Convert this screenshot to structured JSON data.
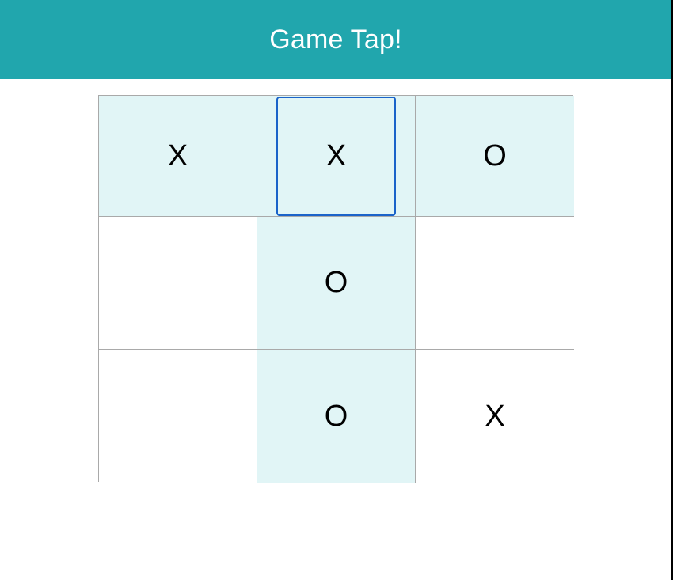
{
  "header": {
    "title": "Game Tap!"
  },
  "colors": {
    "header_bg": "#21a6ad",
    "highlight_cell": "#e1f5f6",
    "empty_cell": "#ffffff",
    "grid_line": "#a9a9a9",
    "focus_ring": "#1a63c9"
  },
  "board": {
    "focused_cell": {
      "row": 0,
      "col": 1
    },
    "cells": [
      [
        {
          "mark": "X",
          "highlighted": true
        },
        {
          "mark": "X",
          "highlighted": true
        },
        {
          "mark": "O",
          "highlighted": true
        }
      ],
      [
        {
          "mark": "",
          "highlighted": false
        },
        {
          "mark": "O",
          "highlighted": true
        },
        {
          "mark": "",
          "highlighted": false
        }
      ],
      [
        {
          "mark": "",
          "highlighted": false
        },
        {
          "mark": "O",
          "highlighted": true
        },
        {
          "mark": "X",
          "highlighted": false
        }
      ]
    ]
  }
}
